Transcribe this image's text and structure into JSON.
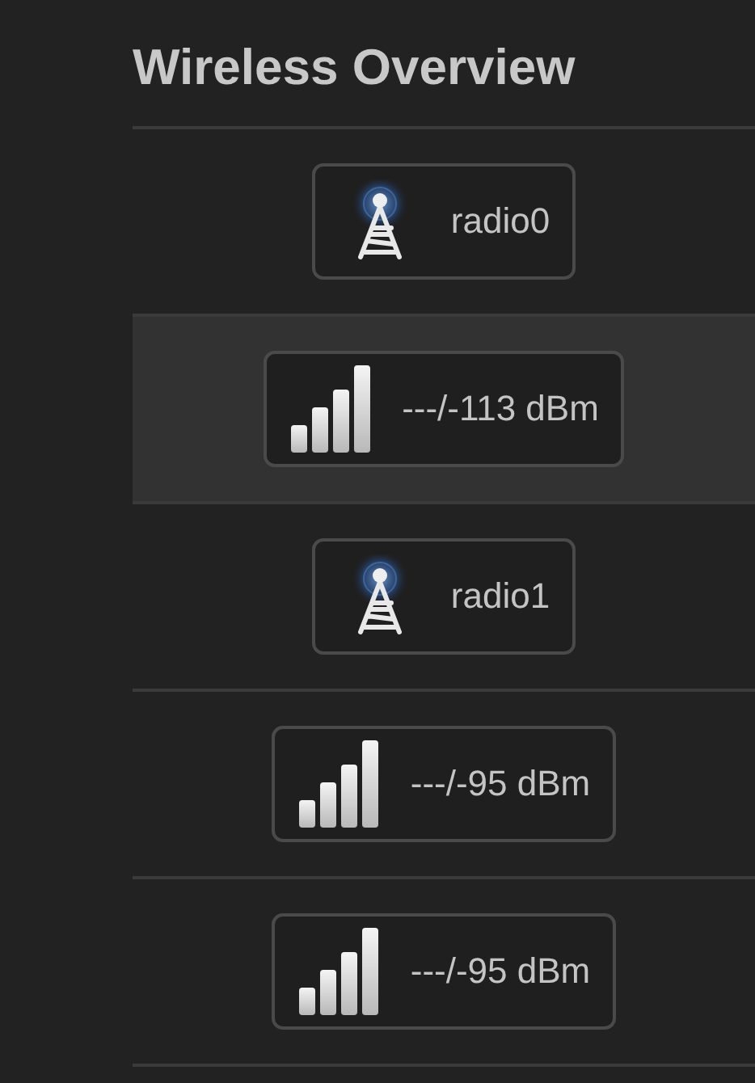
{
  "title": "Wireless Overview",
  "rows": [
    {
      "kind": "radio",
      "label": "radio0",
      "selected": false
    },
    {
      "kind": "signal",
      "label": "---/-113 dBm",
      "selected": true
    },
    {
      "kind": "radio",
      "label": "radio1",
      "selected": false
    },
    {
      "kind": "signal",
      "label": "---/-95 dBm",
      "selected": false
    },
    {
      "kind": "signal",
      "label": "---/-95 dBm",
      "selected": false
    }
  ]
}
